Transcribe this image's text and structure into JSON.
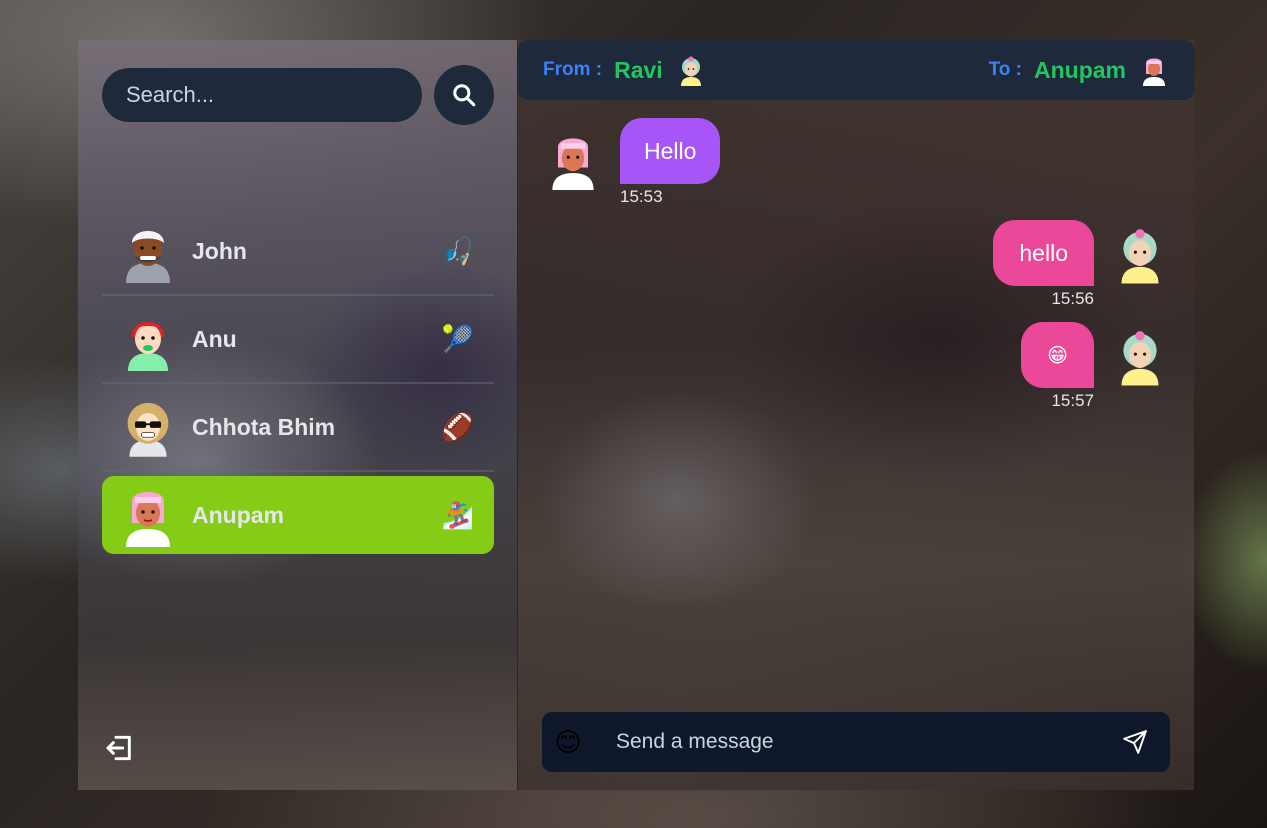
{
  "sidebar": {
    "search_placeholder": "Search...",
    "contacts": [
      {
        "name": "John",
        "avatar": "turban-man-avatar",
        "hobby_icon": "🎣"
      },
      {
        "name": "Anu",
        "avatar": "red-hair-woman-avatar",
        "hobby_icon": "🎾"
      },
      {
        "name": "Chhota Bhim",
        "avatar": "sunglasses-avatar",
        "hobby_icon": "🏈"
      },
      {
        "name": "Anupam",
        "avatar": "pink-hair-avatar",
        "hobby_icon": "🏂",
        "active": true
      }
    ]
  },
  "header": {
    "from_label": "From :",
    "from_name": "Ravi",
    "to_label": "To :",
    "to_name": "Anupam"
  },
  "messages": [
    {
      "direction": "incoming",
      "text": "Hello",
      "time": "15:53"
    },
    {
      "direction": "outgoing",
      "text": "hello",
      "time": "15:56"
    },
    {
      "direction": "outgoing",
      "text": "😁",
      "time": "15:57"
    }
  ],
  "composer": {
    "placeholder": "Send a message",
    "emoji_icon": "😊"
  },
  "colors": {
    "active_contact": "#84cc16",
    "incoming_bubble": "#a855f7",
    "outgoing_bubble": "#ec4899",
    "header_bg": "#1e293b",
    "from_to_label": "#3b82f6",
    "names": "#22c55e"
  }
}
